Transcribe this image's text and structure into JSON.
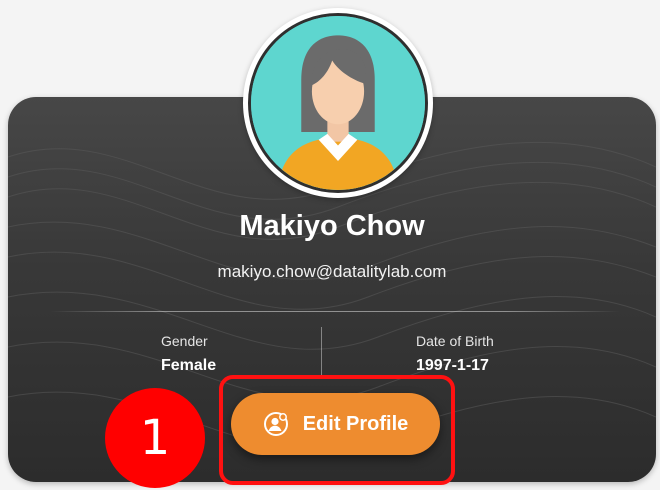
{
  "profile": {
    "name": "Makiyo Chow",
    "email": "makiyo.chow@datalitylab.com",
    "avatar_icon": "female-avatar-icon"
  },
  "details": {
    "gender_label": "Gender",
    "gender_value": "Female",
    "dob_label": "Date of Birth",
    "dob_value": "1997-1-17"
  },
  "actions": {
    "edit_profile_label": "Edit Profile",
    "edit_profile_icon": "user-settings-icon"
  },
  "annotation": {
    "step_number": "1",
    "highlight_color": "#ff1111"
  },
  "colors": {
    "accent": "#ee8c2f",
    "card_background": "#3a3a3a",
    "avatar_background": "#5ed6cf"
  }
}
